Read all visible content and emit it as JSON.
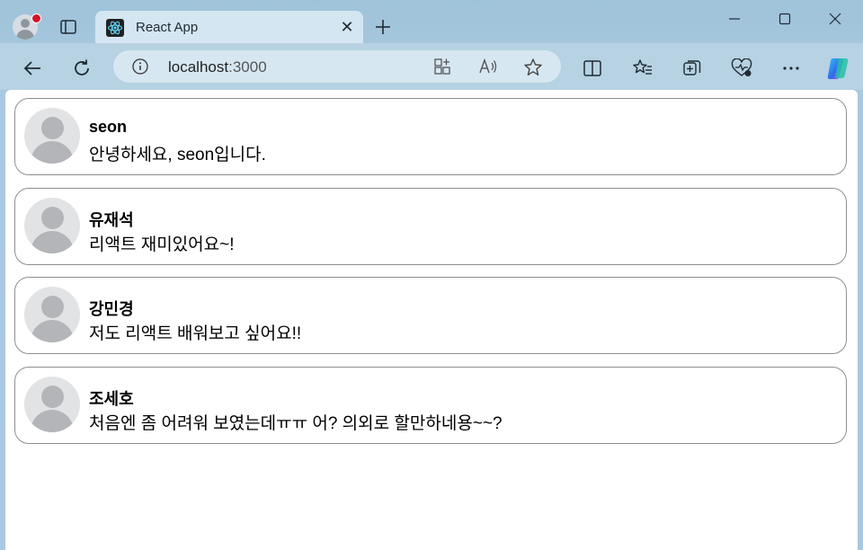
{
  "browser": {
    "tab_title": "React App",
    "url_host": "localhost",
    "url_port": ":3000"
  },
  "comments": [
    {
      "name": "seon",
      "text": "안녕하세요, seon입니다."
    },
    {
      "name": "유재석",
      "text": "리액트 재미있어요~!"
    },
    {
      "name": "강민경",
      "text": "저도 리액트 배워보고 싶어요!!"
    },
    {
      "name": "조세호",
      "text": "처음엔 좀 어려워 보였는데ㅠㅠ 어? 의외로 할만하네용~~?"
    }
  ]
}
